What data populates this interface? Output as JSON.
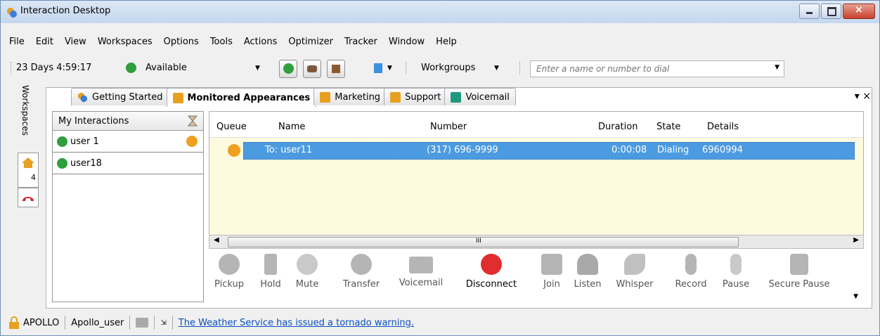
{
  "window": {
    "title": "Interaction Desktop"
  },
  "menu": [
    "File",
    "Edit",
    "View",
    "Workspaces",
    "Options",
    "Tools",
    "Actions",
    "Optimizer",
    "Tracker",
    "Window",
    "Help"
  ],
  "toolbar": {
    "uptime": "23 Days 4:59:17",
    "status": "Available",
    "workgroups": "Workgroups",
    "dial_placeholder": "Enter a name or number to dial"
  },
  "sidebar": {
    "label": "Workspaces",
    "badge": "4"
  },
  "tabs": [
    "Getting Started",
    "Monitored Appearances",
    "Marketing",
    "Support",
    "Voicemail"
  ],
  "my_interactions": {
    "header": "My Interactions",
    "users": [
      "user 1",
      "user18"
    ]
  },
  "grid": {
    "columns": [
      "Queue",
      "Name",
      "Number",
      "Duration",
      "State",
      "Details"
    ],
    "rows": [
      {
        "name": "To: user11",
        "number": "(317) 696-9999",
        "duration": "0:00:08",
        "state": "Dialing",
        "details": "6960994"
      }
    ],
    "scroll_marker": "III"
  },
  "actions": [
    "Pickup",
    "Hold",
    "Mute",
    "Transfer",
    "Voicemail",
    "Disconnect",
    "Join",
    "Listen",
    "Whisper",
    "Record",
    "Pause",
    "Secure Pause"
  ],
  "status": {
    "server": "APOLLO",
    "user": "Apollo_user",
    "message": "The Weather Service has issued a tornado warning."
  }
}
